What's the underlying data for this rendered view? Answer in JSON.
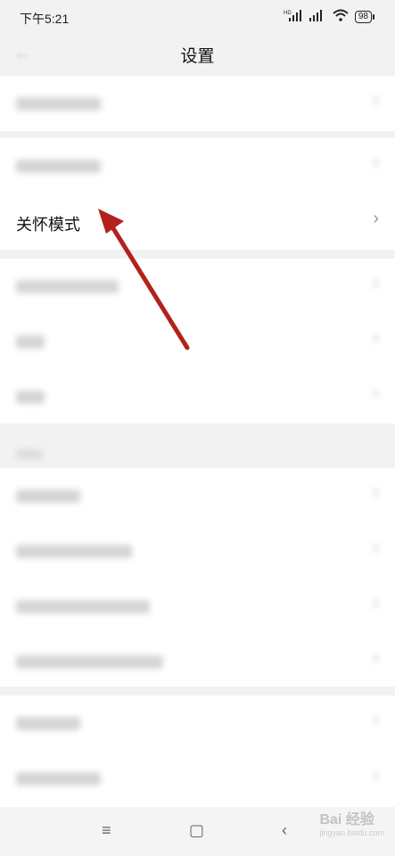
{
  "status_bar": {
    "time": "下午5:21",
    "battery": "98",
    "hd_label": "HD"
  },
  "header": {
    "title": "设置"
  },
  "rows": [
    {
      "label": "",
      "ph_width": 95
    },
    {
      "label": "",
      "ph_width": 95
    },
    {
      "label": "关怀模式"
    },
    {
      "label": "",
      "ph_width": 115
    },
    {
      "label": "",
      "ph_width": 32
    },
    {
      "label": "",
      "ph_width": 32
    },
    {
      "label": "",
      "ph_width": 72
    },
    {
      "label": "",
      "ph_width": 130
    },
    {
      "label": "",
      "ph_width": 150
    },
    {
      "label": "",
      "ph_width": 165
    },
    {
      "label": "",
      "ph_width": 72
    },
    {
      "label": "",
      "ph_width": 95
    }
  ],
  "chevron": "›",
  "nav": {
    "menu": "≡",
    "home": "▢",
    "back": "‹"
  },
  "watermark": {
    "main": "Bai 经验",
    "sub": "jingyan.baidu.com"
  },
  "annotation_color": "#b3211c"
}
